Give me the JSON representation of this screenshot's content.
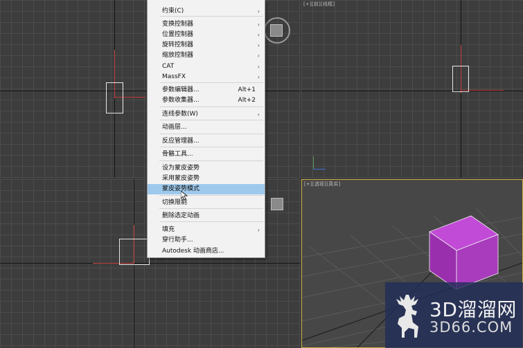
{
  "viewports": {
    "top_right_label": "[+][前][线框]",
    "bottom_right_label": "[+][透视][真实]"
  },
  "context_menu": {
    "items": [
      {
        "label": "约束(C)",
        "shortcut": "",
        "submenu": true
      },
      {
        "label": "变换控制器",
        "shortcut": "",
        "submenu": true
      },
      {
        "label": "位置控制器",
        "shortcut": "",
        "submenu": true
      },
      {
        "label": "旋转控制器",
        "shortcut": "",
        "submenu": true
      },
      {
        "label": "缩放控制器",
        "shortcut": "",
        "submenu": true
      },
      {
        "label": "CAT",
        "shortcut": "",
        "submenu": true
      },
      {
        "label": "MassFX",
        "shortcut": "",
        "submenu": true
      },
      {
        "label": "参数编辑器...",
        "shortcut": "Alt+1",
        "submenu": false
      },
      {
        "label": "参数收集器...",
        "shortcut": "Alt+2",
        "submenu": false
      },
      {
        "label": "连线参数(W)",
        "shortcut": "",
        "submenu": true
      },
      {
        "label": "动画层...",
        "shortcut": "",
        "submenu": false
      },
      {
        "label": "反应管理器...",
        "shortcut": "",
        "submenu": false
      },
      {
        "label": "骨骼工具...",
        "shortcut": "",
        "submenu": false
      },
      {
        "label": "设为蒙皮姿势",
        "shortcut": "",
        "submenu": false
      },
      {
        "label": "采用蒙皮姿势",
        "shortcut": "",
        "submenu": false
      },
      {
        "label": "蒙皮姿势模式",
        "shortcut": "",
        "submenu": false
      },
      {
        "label": "切换限制",
        "shortcut": "",
        "submenu": false
      },
      {
        "label": "删除选定动画",
        "shortcut": "",
        "submenu": false
      },
      {
        "label": "填充",
        "shortcut": "",
        "submenu": true
      },
      {
        "label": "穿行助手...",
        "shortcut": "",
        "submenu": false
      },
      {
        "label": "Autodesk 动画商店...",
        "shortcut": "",
        "submenu": false
      }
    ],
    "highlighted": "蒙皮姿势模式",
    "submenu_arrow": "›"
  },
  "watermark": {
    "line1": "3D溜溜网",
    "line2": "3D66.COM"
  },
  "colors": {
    "viewport_bg": "#3d3d3d",
    "grid": "#4c4c4c",
    "menu_bg": "#f2f2f2",
    "menu_highlight": "#9ec9ec",
    "active_viewport_border": "#c8b23c",
    "box_purple": "#a43ab6",
    "watermark_bg": "#212d58"
  },
  "icons": [
    "deer-logo-icon",
    "submenu-arrow-icon",
    "mouse-cursor-icon"
  ]
}
